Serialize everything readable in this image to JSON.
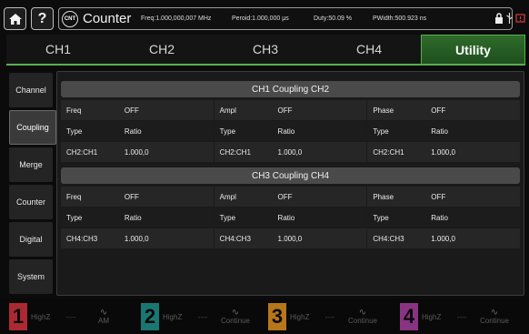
{
  "header": {
    "home_icon": "home-icon",
    "help_label": "?",
    "badge": "CNT",
    "title": "Counter",
    "freq": "Freq:1.000,000,007 MHz",
    "period": "Peroid:1.000,000 μs",
    "duty": "Duty:50.09 %",
    "pwidth": "PWidth:500.923 ns",
    "icons": [
      "lock-icon",
      "usb-icon",
      "warning-icon"
    ]
  },
  "tabs": [
    {
      "label": "CH1"
    },
    {
      "label": "CH2"
    },
    {
      "label": "CH3"
    },
    {
      "label": "CH4"
    },
    {
      "label": "Utility"
    }
  ],
  "menu": [
    {
      "label": "Channel"
    },
    {
      "label": "Coupling"
    },
    {
      "label": "Merge"
    },
    {
      "label": "Counter"
    },
    {
      "label": "Digital"
    },
    {
      "label": "System"
    }
  ],
  "sections": [
    {
      "title": "CH1 Coupling CH2",
      "rows": [
        [
          "Freq",
          "OFF",
          "Ampl",
          "OFF",
          "Phase",
          "OFF"
        ],
        [
          "Type",
          "Ratio",
          "Type",
          "Ratio",
          "Type",
          "Ratio"
        ],
        [
          "CH2:CH1",
          "1.000,0",
          "CH2:CH1",
          "1.000,0",
          "CH2:CH1",
          "1.000,0"
        ]
      ]
    },
    {
      "title": "CH3 Coupling CH4",
      "rows": [
        [
          "Freq",
          "OFF",
          "Ampl",
          "OFF",
          "Phase",
          "OFF"
        ],
        [
          "Type",
          "Ratio",
          "Type",
          "Ratio",
          "Type",
          "Ratio"
        ],
        [
          "CH4:CH3",
          "1.000,0",
          "CH4:CH3",
          "1.000,0",
          "CH4:CH3",
          "1.000,0"
        ]
      ]
    }
  ],
  "bottom": [
    {
      "num": "1",
      "hz": "HighZ",
      "dash": "----",
      "mode": "AM",
      "color": "#c8303a"
    },
    {
      "num": "2",
      "hz": "HighZ",
      "dash": "----",
      "mode": "Continue",
      "color": "#1d8a84"
    },
    {
      "num": "3",
      "hz": "HighZ",
      "dash": "----",
      "mode": "Continue",
      "color": "#d68a1e"
    },
    {
      "num": "4",
      "hz": "HighZ",
      "dash": "----",
      "mode": "Continue",
      "color": "#a03c98"
    }
  ]
}
